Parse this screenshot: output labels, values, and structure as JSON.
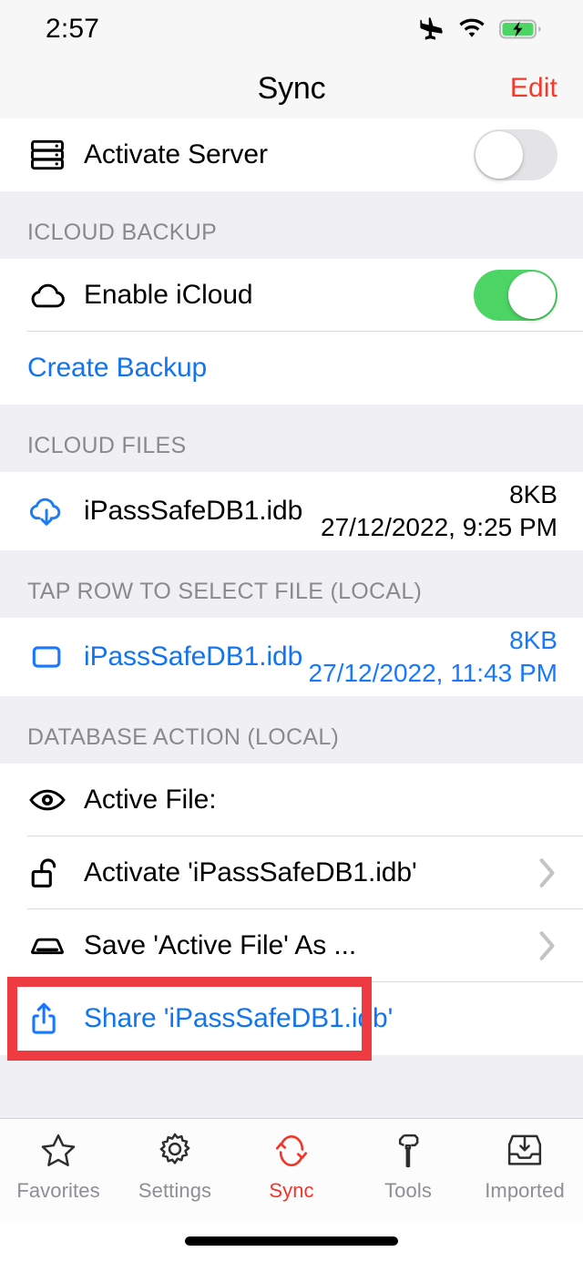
{
  "status_bar": {
    "time": "2:57",
    "icons": [
      "airplane-mode-icon",
      "wifi-icon",
      "battery-charging-icon"
    ]
  },
  "nav_bar": {
    "title": "Sync",
    "edit_label": "Edit",
    "edit_color": "#F23A2E"
  },
  "sections": {
    "server": {
      "rows": [
        {
          "icon": "server-rack-icon",
          "label": "Activate Server",
          "toggle": "off"
        }
      ]
    },
    "icloud_backup": {
      "header": "ICLOUD BACKUP",
      "rows": [
        {
          "icon": "cloud-icon",
          "label": "Enable iCloud",
          "toggle": "on"
        },
        {
          "label": "Create Backup",
          "style": "blue-link"
        }
      ]
    },
    "icloud_files": {
      "header": "ICLOUD FILES",
      "rows": [
        {
          "icon": "cloud-download-icon",
          "label": "iPassSafeDB1.idb",
          "size": "8KB",
          "date": "27/12/2022, 9:25 PM"
        }
      ]
    },
    "local_files": {
      "header": "TAP ROW TO SELECT FILE (LOCAL)",
      "rows": [
        {
          "icon": "checkbox-unchecked-icon",
          "label": "iPassSafeDB1.idb",
          "size": "8KB",
          "date": "27/12/2022, 11:43 PM"
        }
      ]
    },
    "database_action": {
      "header": "DATABASE ACTION (LOCAL)",
      "rows": [
        {
          "icon": "eye-icon",
          "label": "Active File:"
        },
        {
          "icon": "unlock-icon",
          "label": "Activate 'iPassSafeDB1.idb'",
          "chevron": true
        },
        {
          "icon": "hard-drive-icon",
          "label": "Save 'Active File' As ...",
          "chevron": true
        },
        {
          "icon": "share-icon",
          "label": "Share 'iPassSafeDB1.idb'",
          "style": "blue-link",
          "highlighted": true
        }
      ]
    }
  },
  "highlight": {
    "target": "Share 'iPassSafeDB1.idb'",
    "color": "#EE3B42"
  },
  "tab_bar": {
    "tabs": [
      {
        "icon": "star-icon",
        "label": "Favorites",
        "active": false
      },
      {
        "icon": "gear-icon",
        "label": "Settings",
        "active": false
      },
      {
        "icon": "sync-circular-arrows-icon",
        "label": "Sync",
        "active": true
      },
      {
        "icon": "hammer-icon",
        "label": "Tools",
        "active": false
      },
      {
        "icon": "inbox-download-icon",
        "label": "Imported",
        "active": false
      }
    ],
    "active_color": "#F2352B",
    "inactive_color": "#8E8E93"
  },
  "colors": {
    "link_blue": "#1374F0",
    "toggle_on_green": "#4CD464",
    "group_background": "#EFEFF4"
  }
}
